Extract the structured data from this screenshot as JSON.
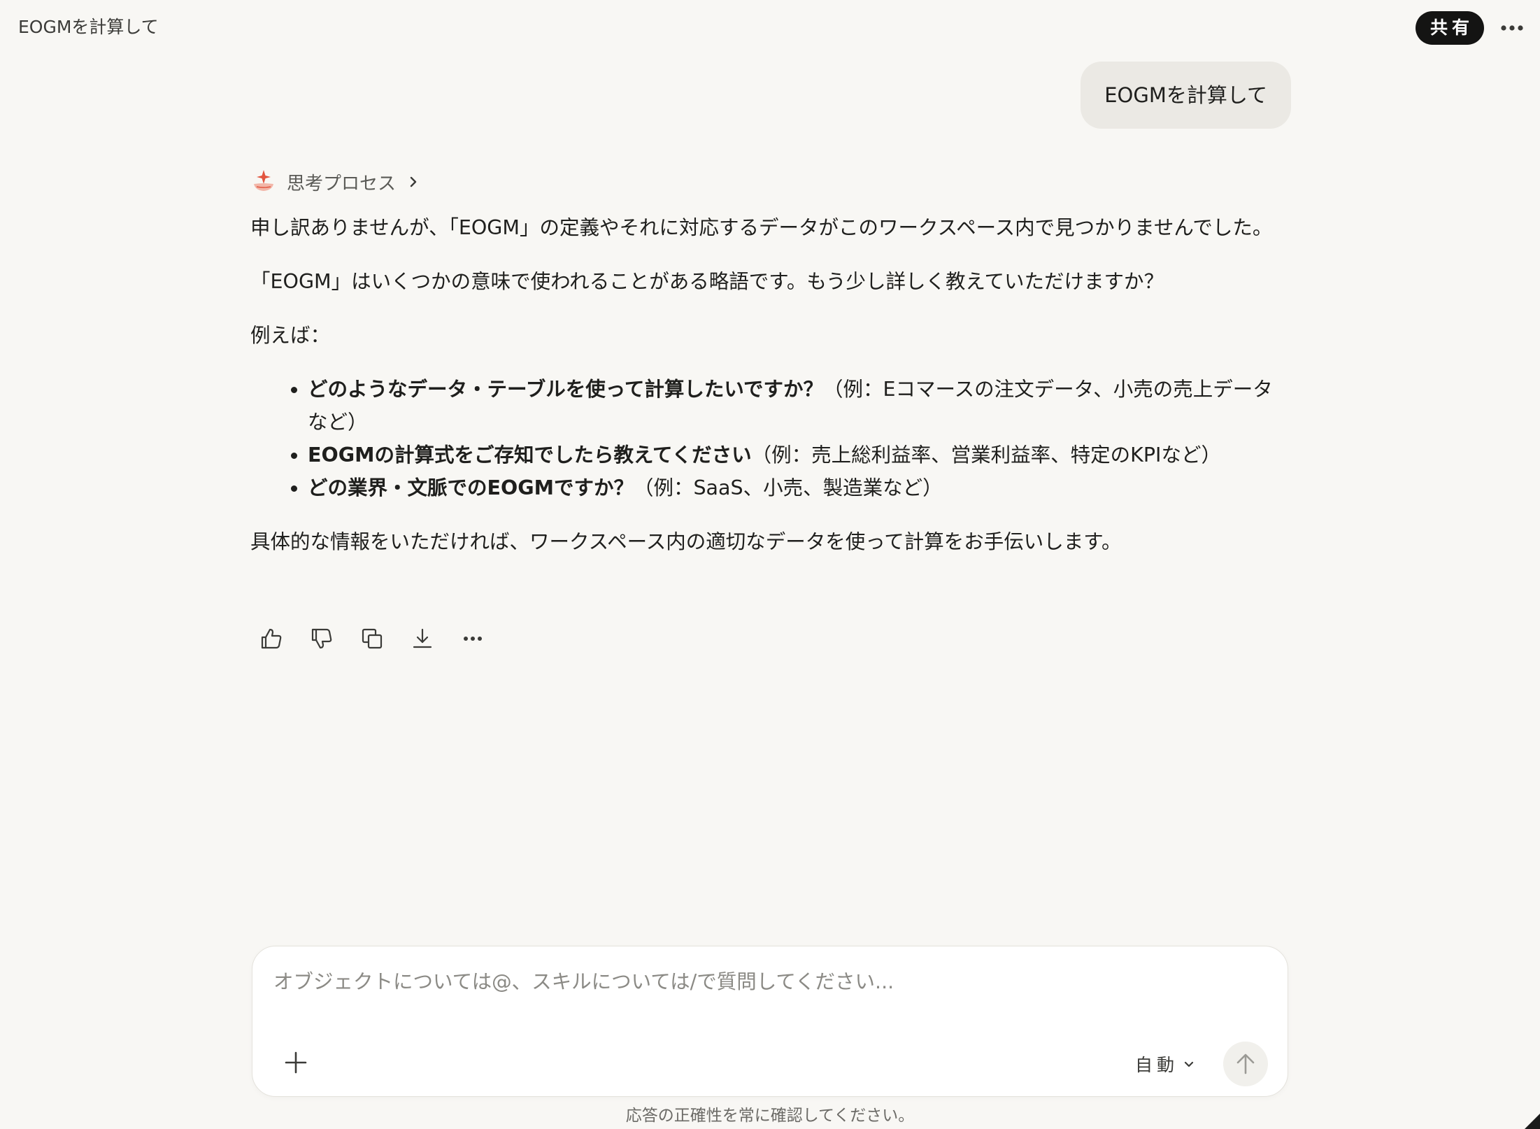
{
  "header": {
    "title": "EOGMを計算して",
    "share_label": "共有"
  },
  "user_message": {
    "text": "EOGMを計算して"
  },
  "assistant": {
    "thinking_label": "思考プロセス",
    "paragraph_1": "申し訳ありませんが、「EOGM」の定義やそれに対応するデータがこのワークスペース内で見つかりませんでした。",
    "paragraph_2": "「EOGM」はいくつかの意味で使われることがある略語です。もう少し詳しく教えていただけますか？",
    "paragraph_3": "例えば：",
    "bullets": [
      {
        "bold": "どのようなデータ・テーブルを使って計算したいですか？",
        "rest": "（例：Eコマースの注文データ、小売の売上データなど）"
      },
      {
        "bold": "EOGMの計算式をご存知でしたら教えてください",
        "rest": "（例：売上総利益率、営業利益率、特定のKPIなど）"
      },
      {
        "bold": "どの業界・文脈でのEOGMですか？",
        "rest": "（例：SaaS、小売、製造業など）"
      }
    ],
    "paragraph_4": "具体的な情報をいただければ、ワークスペース内の適切なデータを使って計算をお手伝いします。"
  },
  "actions": {
    "icons": [
      "thumbs-up-icon",
      "thumbs-down-icon",
      "copy-icon",
      "download-icon",
      "more-icon"
    ]
  },
  "composer": {
    "placeholder": "オブジェクトについては@、スキルについては/で質問してください...",
    "mode_label": "自動"
  },
  "footer": {
    "disclaimer": "応答の正確性を常に確認してください。"
  },
  "colors": {
    "background": "#f8f7f4",
    "user_bubble": "#ebe9e4",
    "share_button": "#141413",
    "accent_spark": "#e2553f"
  }
}
